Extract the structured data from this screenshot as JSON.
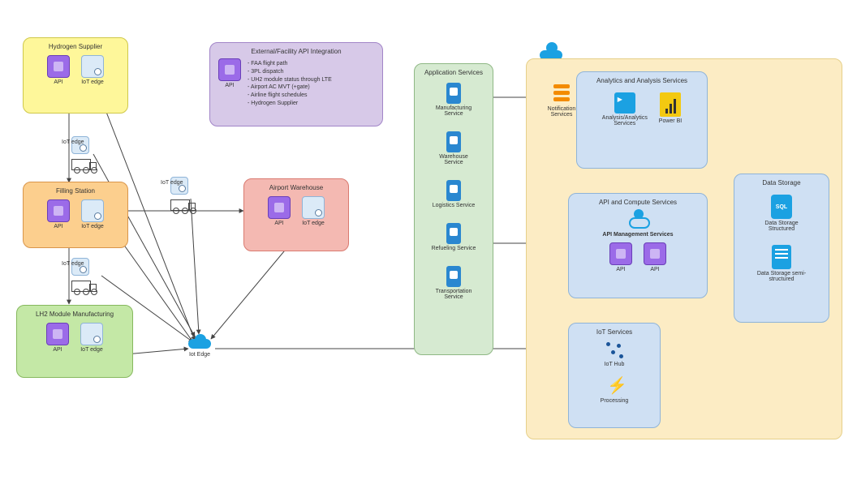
{
  "left": {
    "hydrogen_supplier": {
      "title": "Hydrogen Supplier",
      "api": "API",
      "edge": "IoT edge"
    },
    "filling_station": {
      "title": "Filling Station",
      "api": "API",
      "edge": "IoT edge"
    },
    "lh2_manufacturing": {
      "title": "LH2 Module Manufacturing",
      "api": "API",
      "edge": "IoT edge"
    },
    "airport_warehouse": {
      "title": "Airport Warehouse",
      "api": "API",
      "edge": "IoT edge"
    },
    "truck_edge_label": "IoT edge"
  },
  "external_api": {
    "title": "External/Facility API Integration",
    "api": "API",
    "bullets": [
      "- FAA flight path",
      "- 3PL dispatch",
      "- UH2 module status through LTE",
      "- Airport AC MVT (+gate)",
      "- Airline flight schedules",
      "- Hydrogen Supplier"
    ]
  },
  "iot_edge_label": "Iot Edge",
  "app_services": {
    "title": "Application Services",
    "items": [
      "Manufacturing Service",
      "Warehouse Service",
      "Logistics Service",
      "Refueling Service",
      "Transportation Service"
    ]
  },
  "notif_label": "Notification Services",
  "analytics": {
    "title": "Analytics and Analysis Services",
    "aa": "Analysis/Analytics Services",
    "pb": "Power BI"
  },
  "apim": {
    "title": "API and Compute Services",
    "svc": "API Management Services",
    "api1": "API",
    "api2": "API"
  },
  "iot": {
    "title": "IoT Services",
    "hub": "IoT Hub",
    "proc": "Processing"
  },
  "storage": {
    "title": "Data Storage",
    "sql": "Data Storage Structured",
    "semi": "Data Storage semi-structured"
  }
}
